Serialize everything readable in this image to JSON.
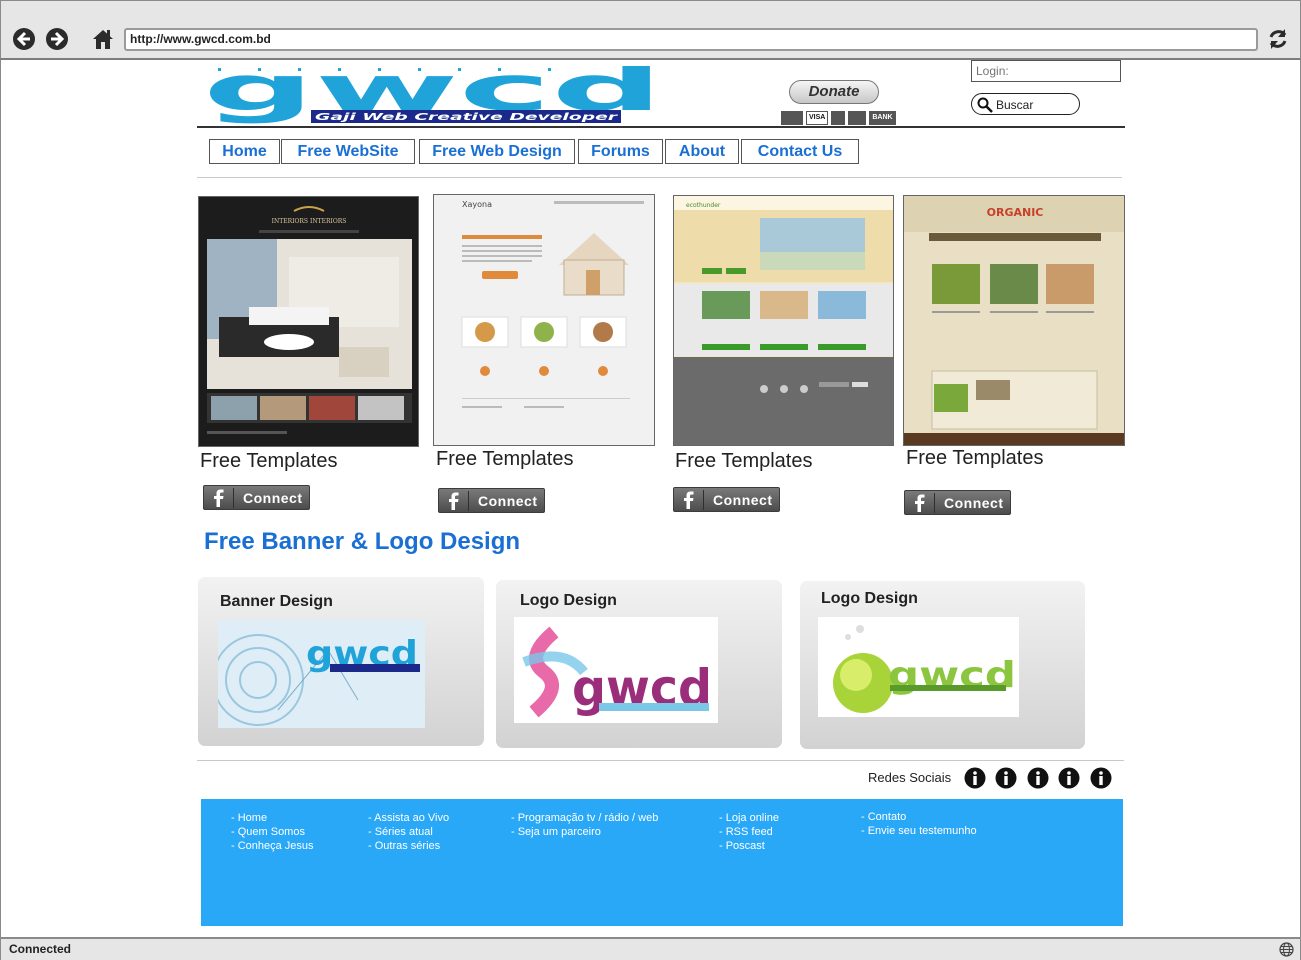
{
  "browser": {
    "url": "http://www.gwcd.com.bd",
    "status": "Connected",
    "icons": [
      "back-icon",
      "forward-icon",
      "home-icon",
      "refresh-icon",
      "globe-icon"
    ]
  },
  "header": {
    "logo_text": "gwcd",
    "logo_tagline": "Gaji Web Creative Developer",
    "donate_label": "Donate",
    "payment_cards": [
      "VISA",
      "BANK"
    ],
    "login_placeholder": "Login:",
    "search_placeholder": "Buscar"
  },
  "nav": {
    "tabs": [
      {
        "label": "Home"
      },
      {
        "label": "Free WebSite"
      },
      {
        "label": "Free Web Design"
      },
      {
        "label": "Forums"
      },
      {
        "label": "About"
      },
      {
        "label": "Contact Us"
      }
    ]
  },
  "templates": {
    "items": [
      {
        "caption": "Free Templates",
        "connect_label": "Connect",
        "thumb_text": "INTERIORS INTERIORS"
      },
      {
        "caption": "Free Templates",
        "connect_label": "Connect",
        "thumb_text": "Xayona"
      },
      {
        "caption": "Free Templates",
        "connect_label": "Connect",
        "thumb_text": "ecothunder"
      },
      {
        "caption": "Free Templates",
        "connect_label": "Connect",
        "thumb_text": "ORGANIC"
      }
    ]
  },
  "design_section": {
    "title": "Free Banner & Logo Design",
    "cards": [
      {
        "title": "Banner Design"
      },
      {
        "title": "Logo Design"
      },
      {
        "title": "Logo Design"
      }
    ],
    "logo_text": "gwcd"
  },
  "social": {
    "label": "Redes Sociais"
  },
  "footer": {
    "columns": [
      [
        "- Home",
        "- Quem Somos",
        "- Conheça Jesus"
      ],
      [
        "- Assista ao Vivo",
        "- Séries atual",
        "- Outras séries"
      ],
      [
        "- Programação tv / rádio / web",
        "- Seja um parceiro"
      ],
      [
        "- Loja online",
        "- RSS feed",
        "- Poscast"
      ],
      [
        "- Contato",
        "- Envie seu testemunho"
      ]
    ]
  },
  "colors": {
    "accent_blue": "#1a6fd4",
    "footer_blue": "#2aa8f8",
    "logo_blue": "#1fa3d8"
  }
}
